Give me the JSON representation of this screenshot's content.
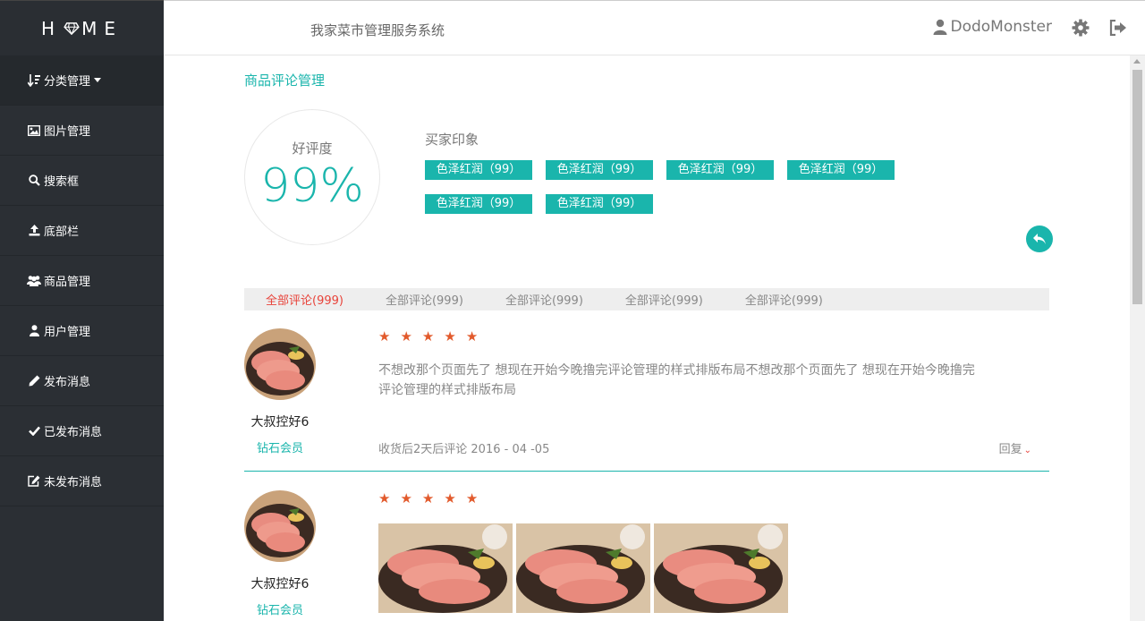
{
  "brand": {
    "logo_left": "H",
    "logo_right": "ME"
  },
  "header": {
    "system_title": "我家菜市管理服务系统",
    "username": "DodoMonster"
  },
  "sidebar": {
    "items": [
      {
        "label": "分类管理",
        "icon": "sort-icon"
      },
      {
        "label": "图片管理",
        "icon": "image-icon"
      },
      {
        "label": "搜索框",
        "icon": "search-icon"
      },
      {
        "label": "底部栏",
        "icon": "upload-icon"
      },
      {
        "label": "商品管理",
        "icon": "users-icon"
      },
      {
        "label": "用户管理",
        "icon": "user-icon"
      },
      {
        "label": "发布消息",
        "icon": "pencil-icon"
      },
      {
        "label": "已发布消息",
        "icon": "check-icon"
      },
      {
        "label": "未发布消息",
        "icon": "edit-icon"
      }
    ]
  },
  "page": {
    "title": "商品评论管理",
    "rating_label": "好评度",
    "rating_value": "99%",
    "impressions_title": "买家印象",
    "tags": [
      "色泽红润（99）",
      "色泽红润（99）",
      "色泽红润（99）",
      "色泽红润（99）",
      "色泽红润（99）",
      "色泽红润（99）"
    ]
  },
  "tabs": [
    "全部评论(999)",
    "全部评论(999)",
    "全部评论(999)",
    "全部评论(999)",
    "全部评论(999)"
  ],
  "reviews": [
    {
      "name": "大叔控好6",
      "level": "钻石会员",
      "stars": 5,
      "text": "不想改那个页面先了 想现在开始今晚撸完评论管理的样式排版布局不想改那个页面先了 想现在开始今晚撸完评论管理的样式排版布局",
      "meta": "收货后2天后评论 2016 - 04 -05",
      "reply": "回复"
    },
    {
      "name": "大叔控好6",
      "level": "钻石会员",
      "stars": 5,
      "photos": 3
    }
  ],
  "colors": {
    "accent": "#1ab5ac",
    "sidebar_bg": "#2b2f34",
    "star": "#e25a2c",
    "active_tab": "#e8433a"
  }
}
